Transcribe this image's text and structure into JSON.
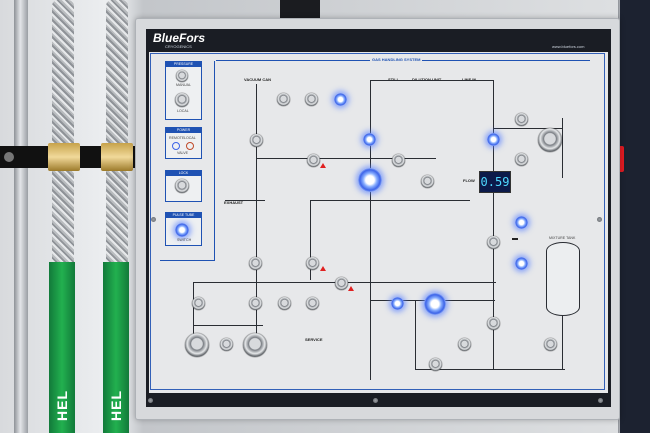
{
  "panel": {
    "brand": "BlueFors",
    "brand_subtitle": "CRYOGENICS",
    "website": "www.bluefors.com",
    "section_title": "GAS HANDLING SYSTEM",
    "flow_label": "FLOW",
    "flow_value": "0.59"
  },
  "side_boxes": [
    {
      "title": "PRESSURE",
      "labels": [
        "MANUAL",
        "LOCAL"
      ]
    },
    {
      "title": "POWER",
      "labels": [
        "REMOTE",
        "LOCAL",
        "VALVE"
      ]
    },
    {
      "title": "LOCK",
      "labels": []
    },
    {
      "title": "PULSE TUBE",
      "labels": [
        "SWITCH"
      ]
    }
  ],
  "top_labels": {
    "vacuum_can": "VACUUM CAN",
    "still": "STILL",
    "dilution_unit": "DILUTION UNIT",
    "line_in": "LINE IN",
    "exhaust": "EXHAUST",
    "service": "SERVICE",
    "mixture_tank": "MIXTURE TANK"
  },
  "hose_text": [
    "HEL",
    "HEL"
  ],
  "colors": {
    "accent_blue": "#1f52b3",
    "lit_blue": "#3d64e8",
    "display_text": "#4fd8ff",
    "warning_red": "#e02020",
    "hose_green": "#22b04f"
  }
}
